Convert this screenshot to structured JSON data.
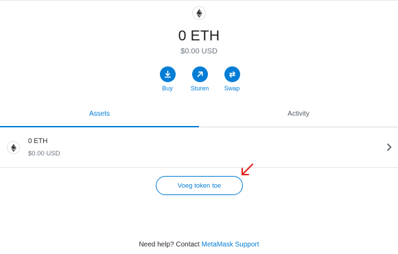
{
  "account": {
    "balance": "0 ETH",
    "fiat_balance": "$0.00 USD",
    "logo_icon": "eth-logo-icon"
  },
  "actions": [
    {
      "label": "Buy",
      "icon": "download-icon"
    },
    {
      "label": "Sturen",
      "icon": "arrow-up-right-icon"
    },
    {
      "label": "Swap",
      "icon": "swap-icon"
    }
  ],
  "tabs": [
    {
      "label": "Assets",
      "active": true
    },
    {
      "label": "Activity",
      "active": false
    }
  ],
  "assets": [
    {
      "amount": "0 ETH",
      "fiat": "$0.00 USD",
      "icon": "eth-logo-icon"
    }
  ],
  "add_token_label": "Voeg token toe",
  "help": {
    "prefix": "Need help? Contact ",
    "link": "MetaMask Support"
  },
  "colors": {
    "accent": "#037dd6",
    "annotation": "#e0201c"
  }
}
